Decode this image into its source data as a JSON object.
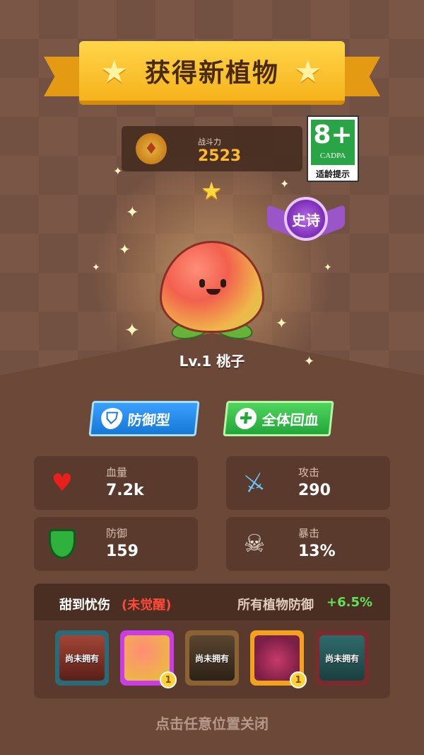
{
  "banner": {
    "title": "获得新植物"
  },
  "power": {
    "label": "战斗力",
    "value": "2523"
  },
  "age_rating": {
    "rating": "8+",
    "org": "CADPA",
    "hint": "适龄提示"
  },
  "rarity": {
    "label": "史诗",
    "color": "#8a3fc4"
  },
  "plant": {
    "name": "Lv.1 桃子"
  },
  "tags": [
    {
      "label": "防御型",
      "icon": "shield-icon",
      "color": "#1677d6"
    },
    {
      "label": "全体回血",
      "icon": "plus-icon",
      "color": "#21a63a"
    }
  ],
  "stats": {
    "hp": {
      "label": "血量",
      "value": "7.2k",
      "icon": "heart-icon"
    },
    "attack": {
      "label": "攻击",
      "value": "290",
      "icon": "sword-icon"
    },
    "defense": {
      "label": "防御",
      "value": "159",
      "icon": "shield-icon"
    },
    "crit": {
      "label": "暴击",
      "value": "13%",
      "icon": "skull-icon"
    }
  },
  "synergy": {
    "name": "甜到忧伤",
    "status": "(未觉醒)",
    "bonus_label": "所有植物防御",
    "bonus_value": "+6.5%",
    "cards": [
      {
        "label": "尚未拥有",
        "owned": false
      },
      {
        "label": "",
        "owned": true,
        "level": "1"
      },
      {
        "label": "尚未拥有",
        "owned": false
      },
      {
        "label": "",
        "owned": true,
        "level": "1"
      },
      {
        "label": "尚未拥有",
        "owned": false
      }
    ]
  },
  "close_hint": "点击任意位置关闭"
}
